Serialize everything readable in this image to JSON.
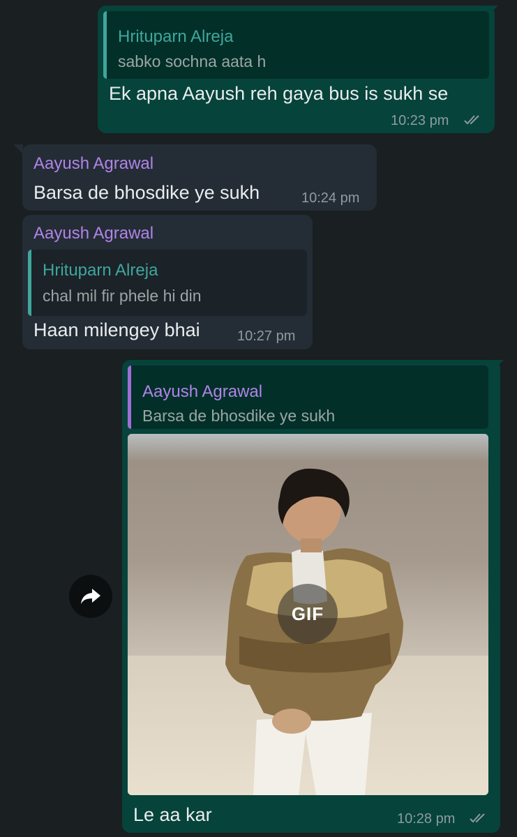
{
  "messages": [
    {
      "direction": "outgoing",
      "quote": {
        "name": "Hrituparn Alreja",
        "text": "sabko sochna aata h"
      },
      "text": "Ek apna Aayush reh gaya bus is sukh se",
      "time": "10:23 pm",
      "status_icon": "double-check-icon"
    },
    {
      "direction": "incoming",
      "sender": "Aayush Agrawal",
      "text": "Barsa de bhosdike ye sukh",
      "time": "10:24 pm"
    },
    {
      "direction": "incoming",
      "sender": "Aayush Agrawal",
      "quote": {
        "name": "Hrituparn Alreja",
        "text": "chal mil fir phele hi din"
      },
      "text": "Haan milengey bhai",
      "time": "10:27 pm"
    },
    {
      "direction": "outgoing",
      "quote": {
        "name": "Aayush Agrawal",
        "text": "Barsa de bhosdike ye sukh"
      },
      "media": {
        "type": "gif",
        "badge": "GIF"
      },
      "text": "Le aa kar",
      "time": "10:28 pm",
      "status_icon": "double-check-icon"
    }
  ],
  "forward_icon": "forward-arrow-icon",
  "colors": {
    "background": "#1a1f21",
    "outgoing_bubble": "#06433b",
    "incoming_bubble": "#242d35",
    "quote_hrituparn": "#3fa79c",
    "quote_aayush": "#a06fd6",
    "sender_aayush": "#b084e9"
  }
}
